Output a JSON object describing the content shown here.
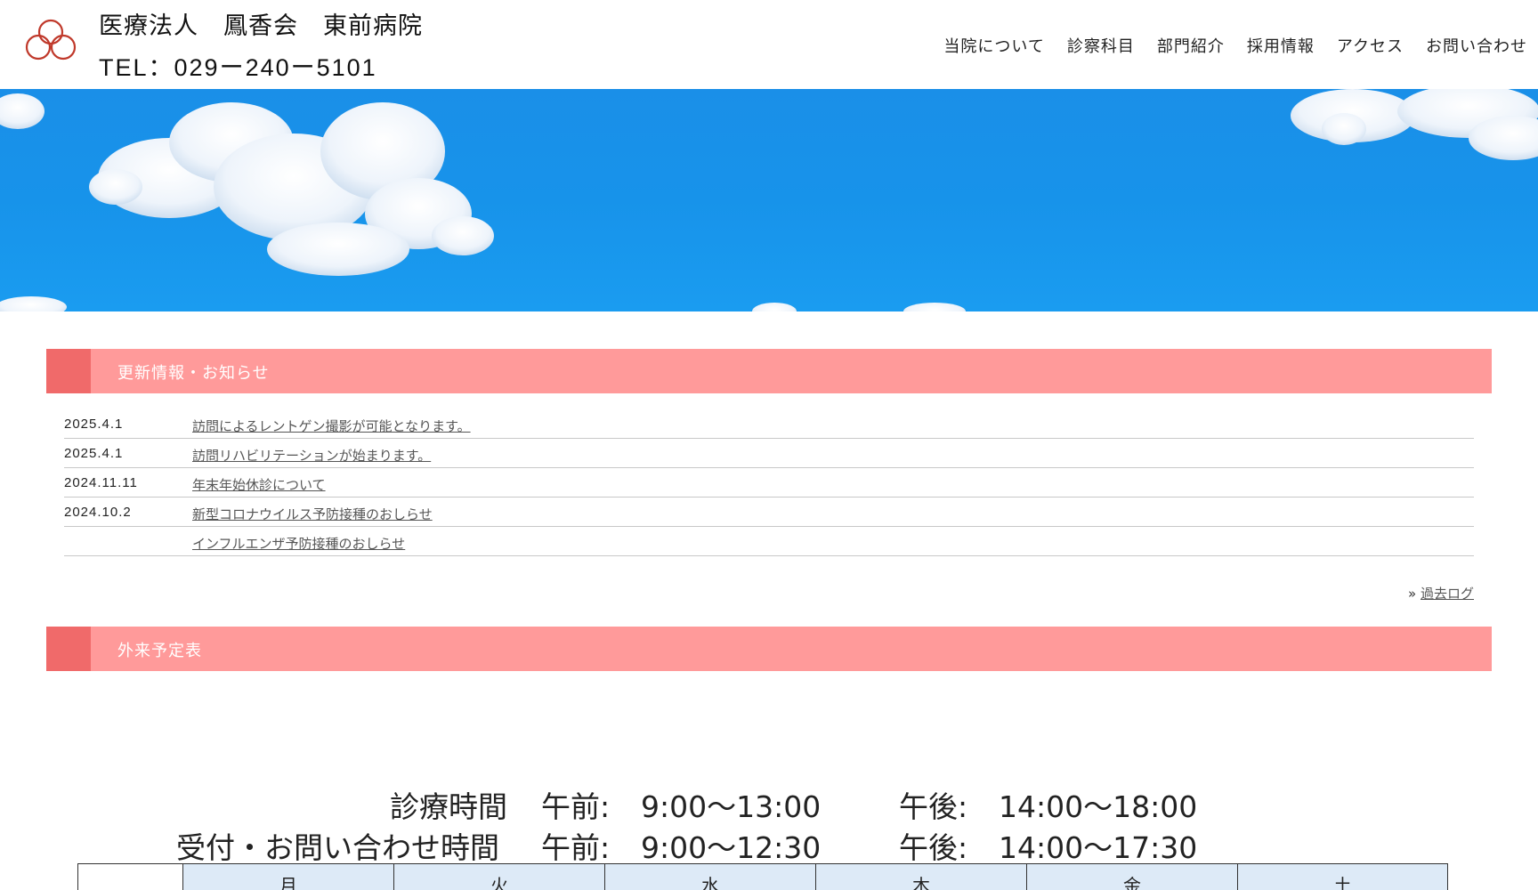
{
  "header": {
    "name": "医療法人　鳳香会　東前病院",
    "tel": "TEL：029ー240ー5101",
    "nav": [
      "当院について",
      "診察科目",
      "部門紹介",
      "採用情報",
      "アクセス",
      "お問い合わせ"
    ]
  },
  "news": {
    "title": "更新情報・お知らせ",
    "items": [
      {
        "date": "2025.4.1",
        "text": "訪問によるレントゲン撮影が可能となります。"
      },
      {
        "date": "2025.4.1",
        "text": "訪問リハビリテーションが始まります。"
      },
      {
        "date": "2024.11.11",
        "text": "年末年始休診について"
      },
      {
        "date": "2024.10.2",
        "text": "新型コロナウイルス予防接種のおしらせ"
      },
      {
        "date": "",
        "text": "インフルエンザ予防接種のおしらせ"
      }
    ],
    "more_prefix": "»",
    "more_label": "過去ログ"
  },
  "schedule": {
    "title": "外来予定表",
    "hours1": {
      "label": "診療時間",
      "am_label": "午前:",
      "am": "9:00～13:00",
      "pm_label": "午後:",
      "pm": "14:00～18:00"
    },
    "hours2": {
      "label": "受付・お問い合わせ時間",
      "am_label": "午前:",
      "am": "9:00～12:30",
      "pm_label": "午後:",
      "pm": "14:00～17:30"
    },
    "days": [
      "",
      "月",
      "火",
      "水",
      "木",
      "金",
      "土"
    ]
  },
  "colors": {
    "bar": "#ff9a9a",
    "bar_accent": "#f06a6a",
    "sky": "#1793ea",
    "logo": "#c0392b"
  }
}
